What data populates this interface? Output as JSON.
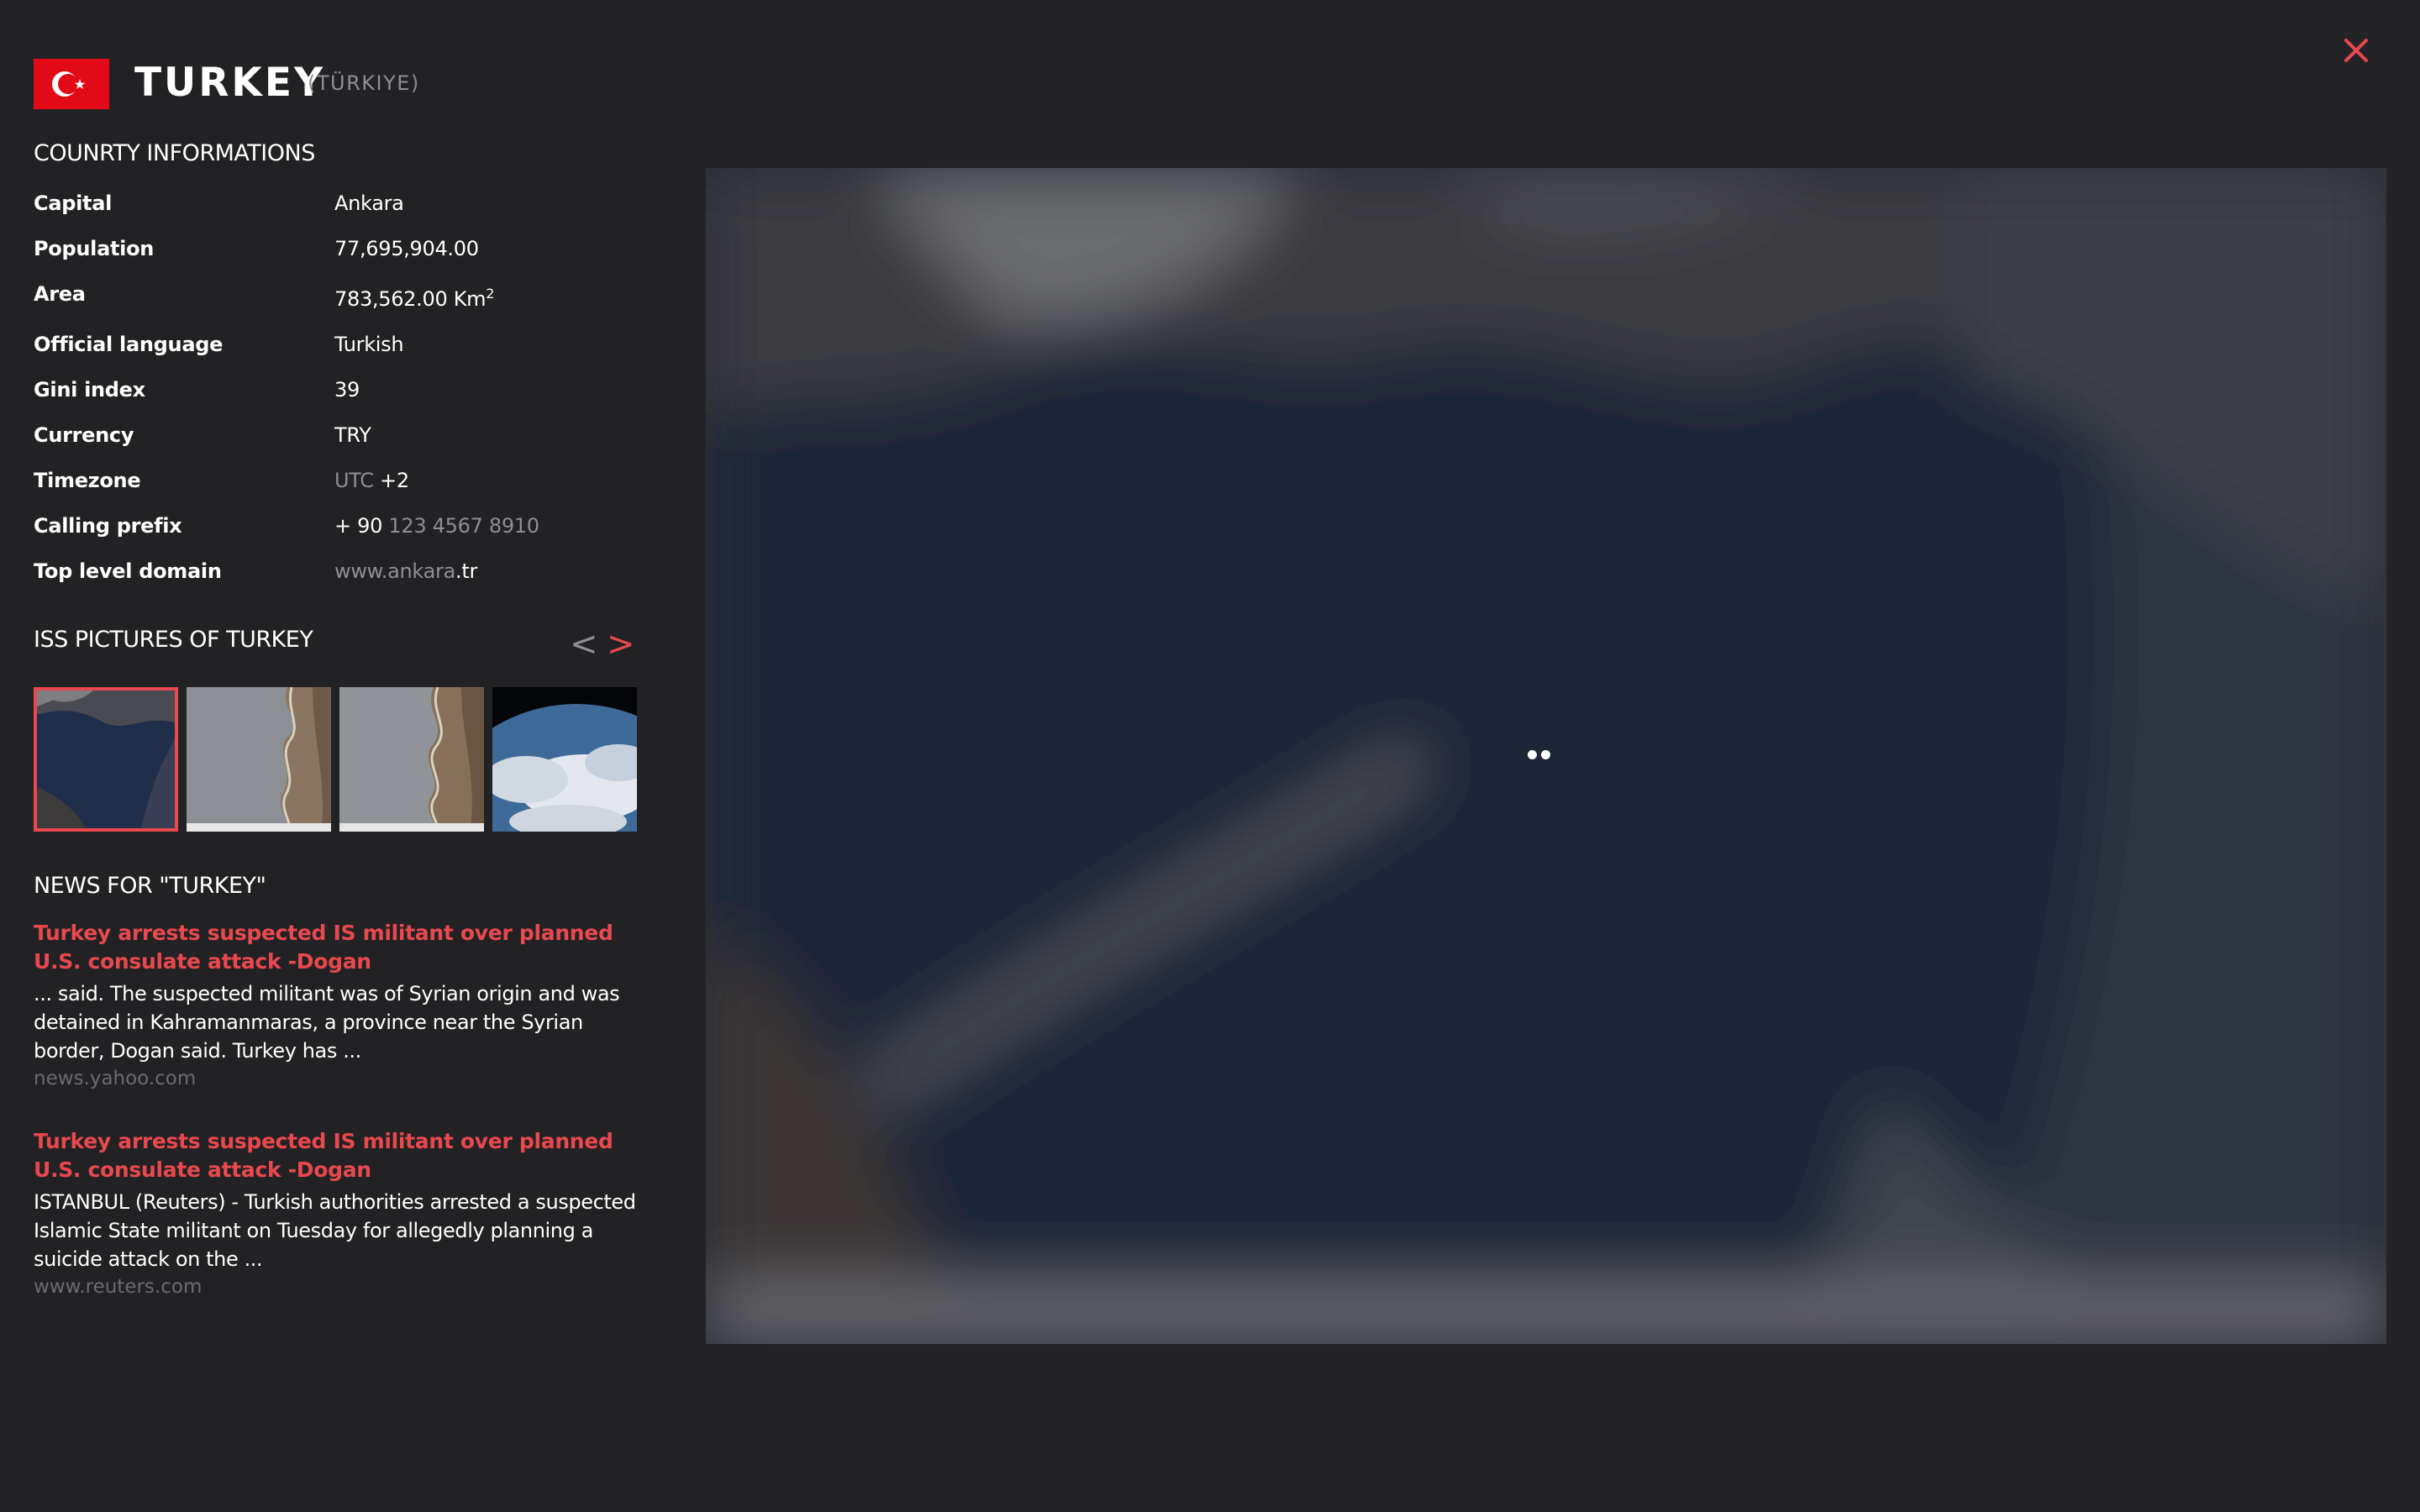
{
  "country": {
    "name": "TURKEY",
    "native_name": "(TÜRKIYE)",
    "flag_icon": "turkey-flag-icon",
    "flag_color": "#e30a17"
  },
  "info_section": {
    "title": "COUNRTY INFORMATIONS",
    "rows": [
      {
        "label": "Capital",
        "value": "Ankara"
      },
      {
        "label": "Population",
        "value": "77,695,904.00"
      },
      {
        "label": "Area",
        "value": "783,562.00 Km",
        "superscript": "2"
      },
      {
        "label": "Official language",
        "value": "Turkish"
      },
      {
        "label": "Gini index",
        "value": "39"
      },
      {
        "label": "Currency",
        "value": "TRY"
      },
      {
        "label": "Timezone",
        "value_muted": "UTC",
        "value": "+2"
      },
      {
        "label": "Calling prefix",
        "value": "+ 90",
        "value_muted": "123 4567 8910"
      },
      {
        "label": "Top level domain",
        "value_muted": "www.ankara",
        "value": ".tr"
      }
    ]
  },
  "gallery": {
    "title": "ISS PICTURES OF TURKEY",
    "prev_label": "<",
    "next_label": ">",
    "thumbnails": [
      {
        "name": "iss-photo-sea",
        "active": true
      },
      {
        "name": "iss-photo-coast-1",
        "active": false
      },
      {
        "name": "iss-photo-coast-2",
        "active": false
      },
      {
        "name": "iss-photo-earth-clouds",
        "active": false
      }
    ]
  },
  "news": {
    "title": "NEWS FOR \"TURKEY\"",
    "items": [
      {
        "title": "Turkey arrests suspected IS militant over planned U.S. consulate attack -Dogan",
        "snippet": "... said. The suspected militant was of Syrian origin and was detained in Kahramanmaras, a province near the Syrian border, Dogan said. Turkey has ...",
        "source": "news.yahoo.com"
      },
      {
        "title": "Turkey arrests suspected IS militant over planned U.S. consulate attack -Dogan",
        "snippet": "ISTANBUL (Reuters) - Turkish authorities arrested a suspected Islamic State militant on Tuesday for allegedly planning a suicide attack on the ...",
        "source": "www.reuters.com"
      }
    ]
  },
  "close_icon": "close-icon",
  "accent_color": "#e8484e",
  "background_color": "#222225"
}
